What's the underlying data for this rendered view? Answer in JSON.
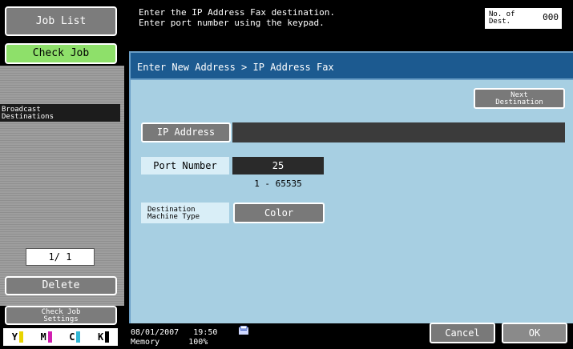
{
  "left_panel": {
    "job_list_label": "Job List",
    "check_job_label": "Check Job",
    "broadcast_label_1": "Broadcast",
    "broadcast_label_2": "Destinations",
    "page_indicator": "1/  1",
    "delete_label": "Delete",
    "check_settings_1": "Check Job",
    "check_settings_2": "Settings",
    "toner": [
      {
        "letter": "Y",
        "color": "#e8d400"
      },
      {
        "letter": "M",
        "color": "#d11fb0"
      },
      {
        "letter": "C",
        "color": "#32b8d6"
      },
      {
        "letter": "K",
        "color": "#000000"
      }
    ]
  },
  "header": {
    "message_line_1": "Enter the IP Address Fax destination.",
    "message_line_2": "Enter port number using the keypad.",
    "dest_label_1": "No. of",
    "dest_label_2": "Dest.",
    "dest_count": "000"
  },
  "main": {
    "title": "Enter New Address > IP Address Fax",
    "next_dest_1": "Next",
    "next_dest_2": "Destination",
    "ip_address_label": "IP Address",
    "ip_address_value": "",
    "port_number_label": "Port Number",
    "port_number_value": "25",
    "port_range": "1  -  65535",
    "dest_machine_type_1": "Destination",
    "dest_machine_type_2": "Machine Type",
    "machine_type_value": "Color"
  },
  "footer": {
    "date": "08/01/2007",
    "time": "19:50",
    "memory_label": "Memory",
    "memory_value": "100%",
    "cancel_label": "Cancel",
    "ok_label": "OK"
  }
}
